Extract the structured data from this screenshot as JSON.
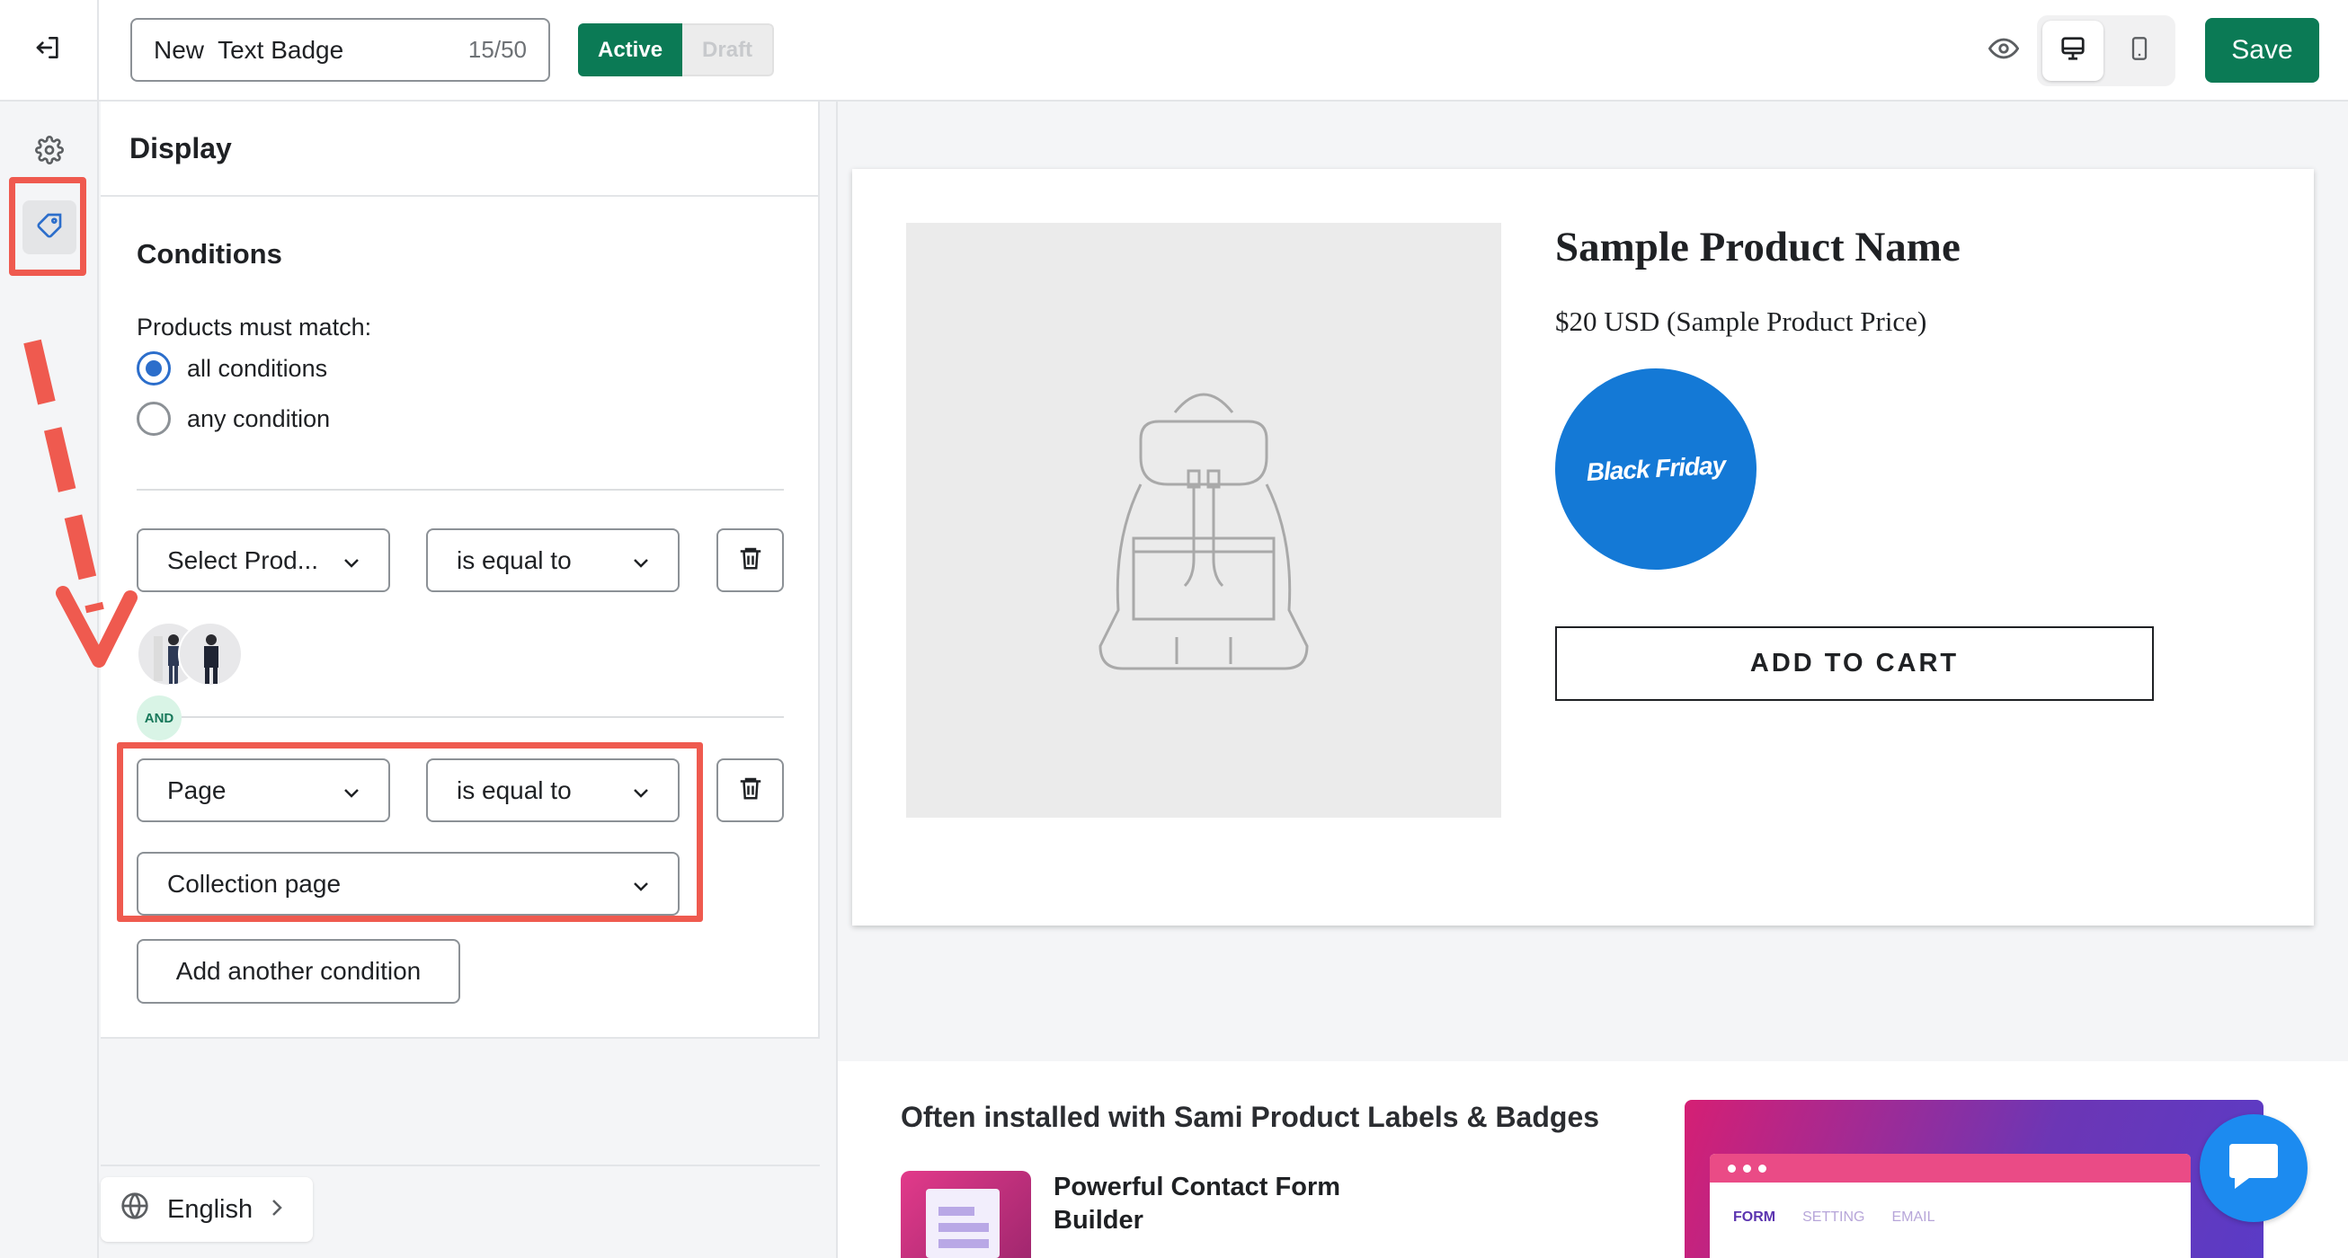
{
  "header": {
    "badge_name_value": "New  Text Badge",
    "char_count": "15/50",
    "status_active": "Active",
    "status_draft": "Draft",
    "save_label": "Save"
  },
  "panel": {
    "title": "Display",
    "section_title": "Conditions",
    "match_label": "Products must match:",
    "radio_all": "all conditions",
    "radio_any": "any condition",
    "condition1": {
      "field": "Select Prod...",
      "operator": "is equal to"
    },
    "and_label": "AND",
    "condition2": {
      "field": "Page",
      "operator": "is equal to",
      "value": "Collection page"
    },
    "add_condition": "Add another condition"
  },
  "language": {
    "label": "English"
  },
  "preview": {
    "product_name": "Sample Product Name",
    "product_price": "$20 USD (Sample Product Price)",
    "badge_text": "Black Friday",
    "add_to_cart": "ADD TO CART",
    "promo_title": "Often installed with Sami Product Labels & Badges",
    "promo_app_name": "Powerful Contact Form Builder",
    "promo_tabs": [
      "FORM",
      "SETTING",
      "EMAIL"
    ]
  },
  "colors": {
    "primary_green": "#0b7a55",
    "badge_blue": "#1479d6",
    "highlight_red": "#ef5a4f",
    "radio_blue": "#2c6ecb"
  }
}
